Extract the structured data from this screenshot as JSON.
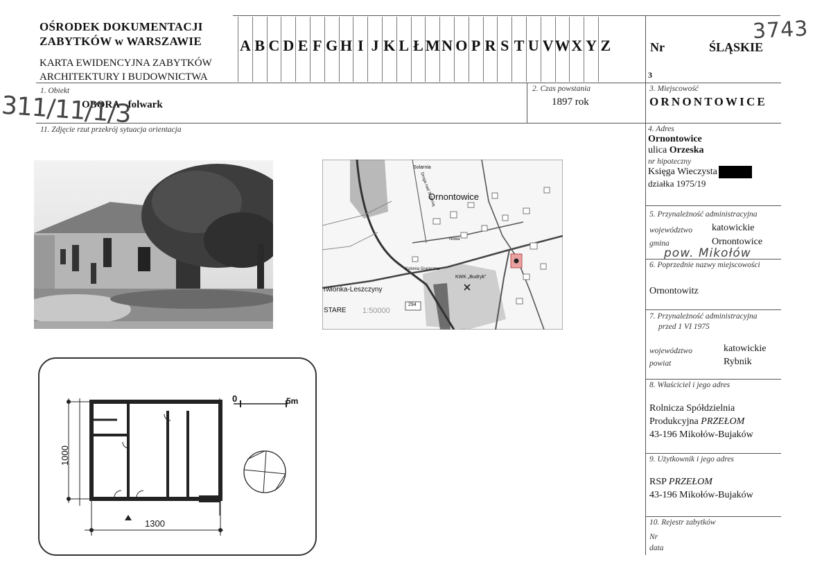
{
  "header": {
    "institution_line1": "OŚRODEK DOKUMENTACJI",
    "institution_line2": "ZABYTKÓW w WARSZAWIE",
    "card_line1": "KARTA EWIDENCYJNA ZABYTKÓW",
    "card_line2": "ARCHITEKTURY I BUDOWNICTWA",
    "letters": [
      "A",
      "B",
      "C",
      "D",
      "E",
      "F",
      "G",
      "H",
      "I",
      "J",
      "K",
      "L",
      "Ł",
      "M",
      "N",
      "O",
      "P",
      "R",
      "S",
      "T",
      "U",
      "V",
      "W",
      "X",
      "Y",
      "Z"
    ],
    "nr_label": "Nr",
    "region": "ŚLĄSKIE",
    "handwritten_number": "3743",
    "nr_value": "3"
  },
  "handwritten_code": "311/11/1/3",
  "section1": {
    "label": "1.  Obiekt",
    "value": "OBORA - folwark"
  },
  "section2": {
    "label": "2.  Czas powstania",
    "value": "1897 rok"
  },
  "section3": {
    "label": "3.  Miejscowość",
    "value": "ORNONTOWICE"
  },
  "section11": {
    "label": "11.  Zdjęcie rzut przekrój sytuacja orientacja"
  },
  "section4": {
    "label": "4.  Adres",
    "town": "Ornontowice",
    "street_prefix": "ulica",
    "street": "Orzeska",
    "mortgage_label": "nr hipoteczny",
    "land_register": "Księga Wieczysta",
    "plot": "działka 1975/19"
  },
  "section5": {
    "label": "5.  Przynależność administracyjna",
    "voivodeship_label": "województwo",
    "voivodeship": "katowickie",
    "commune_label": "gmina",
    "commune": "Ornontowice",
    "handwritten_county": "pow. Mikołów"
  },
  "section6": {
    "label": "6.  Poprzednie nazwy miejscowości",
    "value": "Ornontowitz"
  },
  "section7": {
    "label": "7.  Przynależność administracyjna",
    "label2": "przed 1 VI 1975",
    "voivodeship_label": "województwo",
    "voivodeship": "katowickie",
    "county_label": "powiat",
    "county": "Rybnik"
  },
  "section8": {
    "label": "8.  Właściciel i jego adres",
    "line1": "Rolnicza Spółdzielnia",
    "line2_prefix": "Produkcyjna",
    "line2_italic": "PRZEŁOM",
    "line3": "43-196 Mikołów-Bujaków"
  },
  "section9": {
    "label": "9.  Użytkownik  i jego adres",
    "line1_prefix": "RSP",
    "line1_italic": "PRZEŁOM",
    "line2": "43-196 Mikołów-Bujaków"
  },
  "section10": {
    "label": "10.  Rejestr zabytków",
    "nr_label": "Nr",
    "date_label": "data"
  },
  "map": {
    "town": "Ornontowice",
    "solarnia": "Solarnia",
    "kolonia": "Kolonia Graniczna",
    "mine": "KWK „Budryk”",
    "left_town": "rwionka-Leszczyny",
    "stare": "STARE",
    "scale": "1:50000",
    "road": "294",
    "street1": "Nowa",
    "street2": "Droga nad Solarnią"
  },
  "plan": {
    "scale_zero": "0",
    "scale_end": "5m",
    "dim_height": "1000",
    "dim_width": "1300"
  },
  "colors": {
    "redaction": "#000000",
    "map_marker": "#e9a0a0",
    "ink": "#111111"
  }
}
